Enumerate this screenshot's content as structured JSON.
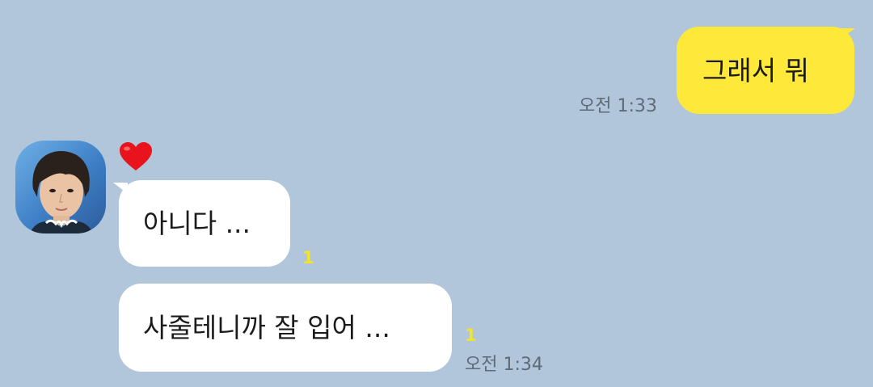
{
  "messages": [
    {
      "id": "sent-1",
      "direction": "sent",
      "text": "그래서 뭐",
      "time": "오전 1:33"
    },
    {
      "id": "recv-1",
      "direction": "received",
      "text": "아니다 ...",
      "unread_count": "1",
      "reaction": "heart"
    },
    {
      "id": "recv-2",
      "direction": "received",
      "text": "사줄테니까 잘 입어 ...",
      "unread_count": "1",
      "time": "오전 1:34"
    }
  ],
  "colors": {
    "background": "#b1c6da",
    "sent_bubble": "#fee93a",
    "received_bubble": "#ffffff",
    "unread_count": "#f1e32f",
    "time_text": "#5e6b78"
  }
}
